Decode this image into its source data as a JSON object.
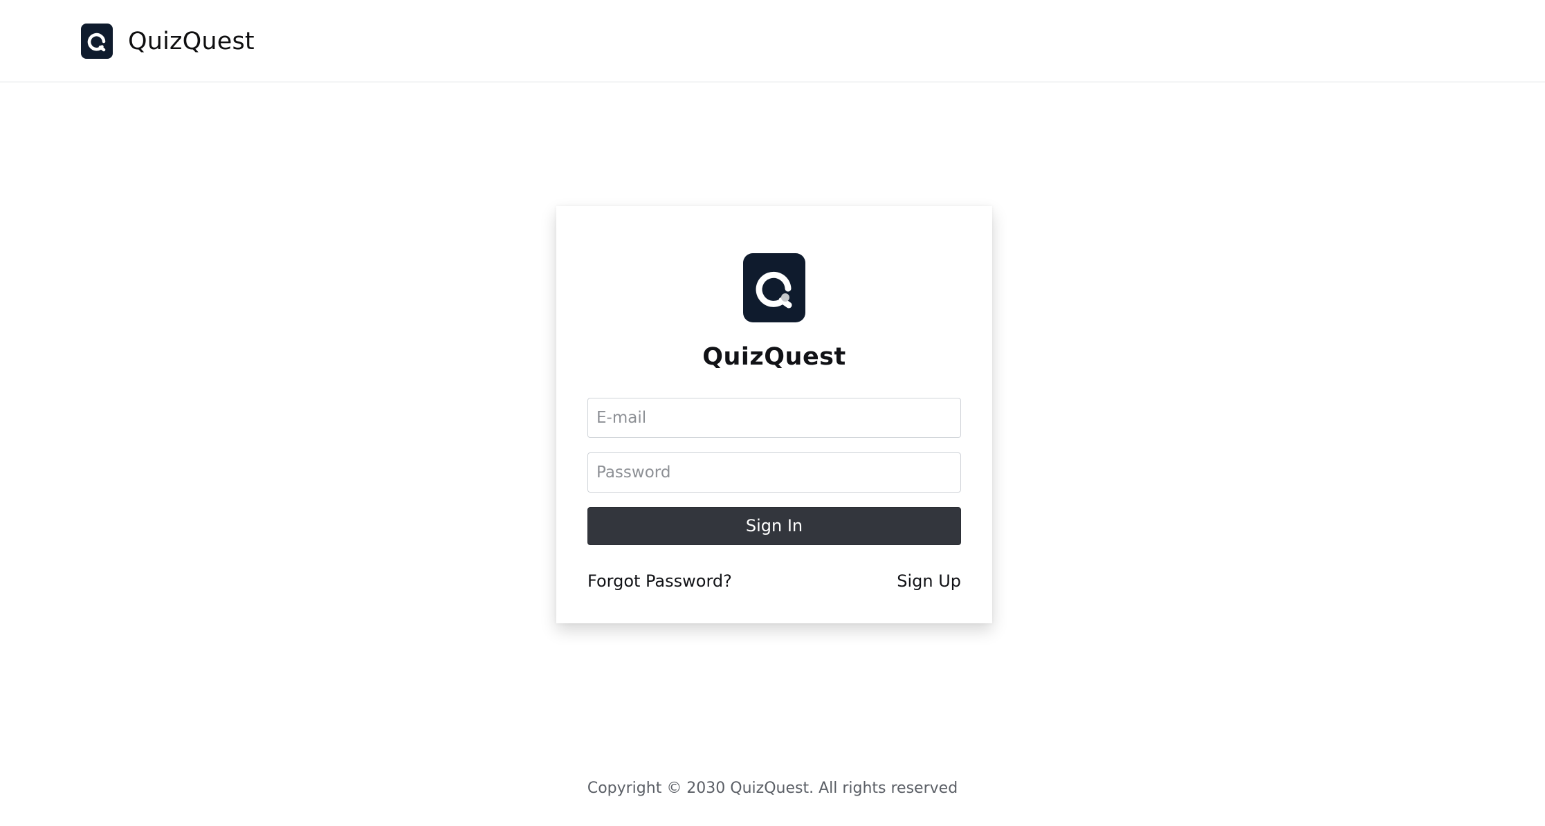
{
  "header": {
    "logo_icon": "quizquest-logo-icon",
    "title": "QuizQuest"
  },
  "card": {
    "logo_icon": "quizquest-logo-icon",
    "title": "QuizQuest",
    "email_placeholder": "E-mail",
    "email_value": "",
    "password_placeholder": "Password",
    "password_value": "",
    "signin_label": "Sign In",
    "forgot_label": "Forgot Password?",
    "signup_label": "Sign Up"
  },
  "footer": {
    "copyright": "Copyright © 2030 QuizQuest. All rights reserved"
  },
  "colors": {
    "brand_dark": "#0f1b2d",
    "button": "#33363d",
    "border": "#cfd3d8"
  }
}
